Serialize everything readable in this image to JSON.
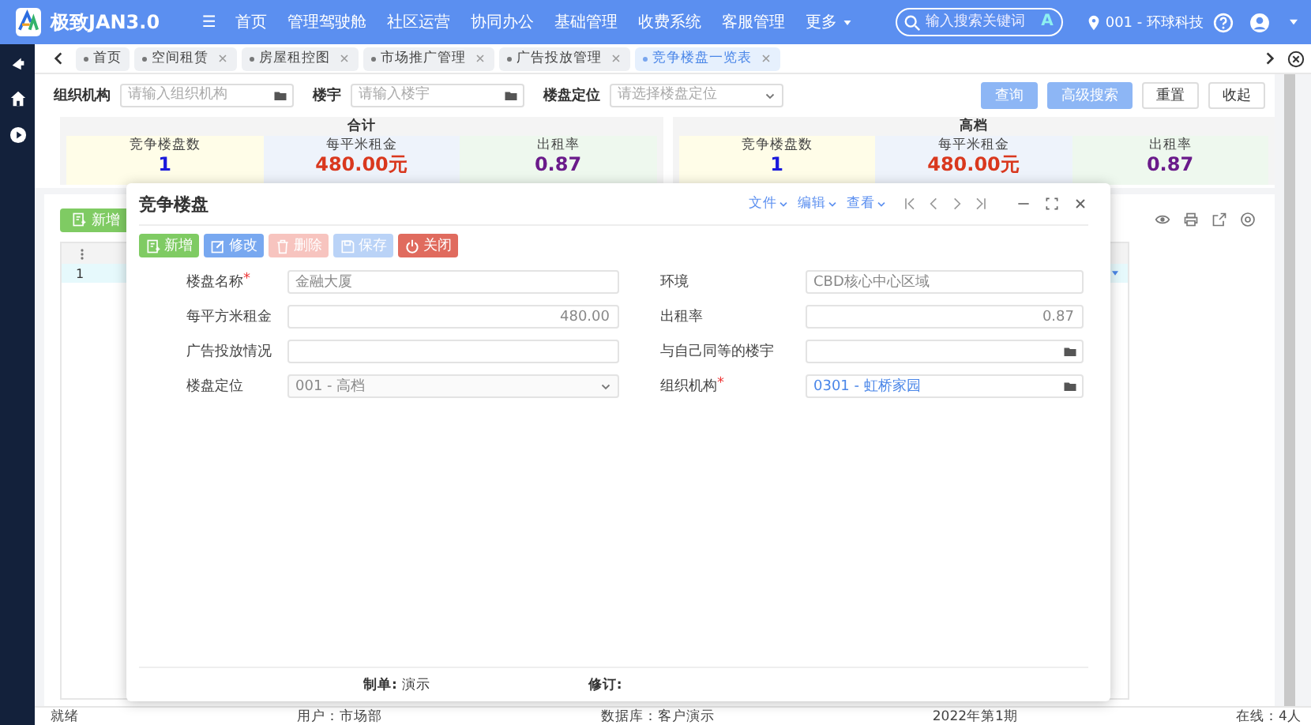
{
  "app": {
    "logo_text": "极致JAN3.0",
    "menu_icon": "☰",
    "nav": [
      "首页",
      "管理驾驶舱",
      "社区运营",
      "协同办公",
      "基础管理",
      "收费系统",
      "客服管理"
    ],
    "more": "更多",
    "search_placeholder": "输入搜索关键词",
    "search_badge": "A",
    "org": "001 - 环球科技"
  },
  "tabs": [
    {
      "label": "首页",
      "selected": false,
      "closable": false
    },
    {
      "label": "空间租赁",
      "selected": false,
      "closable": true
    },
    {
      "label": "房屋租控图",
      "selected": false,
      "closable": true
    },
    {
      "label": "市场推广管理",
      "selected": false,
      "closable": true
    },
    {
      "label": "广告投放管理",
      "selected": false,
      "closable": true
    },
    {
      "label": "竞争楼盘一览表",
      "selected": true,
      "closable": true
    }
  ],
  "filters": [
    {
      "label": "组织机构",
      "placeholder": "请输入组织机构",
      "kind": "picker"
    },
    {
      "label": "楼宇",
      "placeholder": "请输入楼宇",
      "kind": "picker"
    },
    {
      "label": "楼盘定位",
      "placeholder": "请选择楼盘定位",
      "kind": "select"
    }
  ],
  "filter_buttons": [
    {
      "label": "查询",
      "kind": "primary"
    },
    {
      "label": "高级搜索",
      "kind": "primary"
    },
    {
      "label": "重置",
      "kind": "default"
    },
    {
      "label": "收起",
      "kind": "default"
    }
  ],
  "summary": [
    {
      "title": "合计",
      "metrics": [
        {
          "label": "竞争楼盘数",
          "value": "1",
          "color": "#1a1adb"
        },
        {
          "label": "每平米租金",
          "value": "480.00元",
          "color": "#d9381e"
        },
        {
          "label": "出租率",
          "value": "0.87",
          "color": "#6a1b8a"
        }
      ]
    },
    {
      "title": "高档",
      "metrics": [
        {
          "label": "竞争楼盘数",
          "value": "1",
          "color": "#1a1adb"
        },
        {
          "label": "每平米租金",
          "value": "480.00元",
          "color": "#d9381e"
        },
        {
          "label": "出租率",
          "value": "0.87",
          "color": "#6a1b8a"
        }
      ]
    }
  ],
  "list": {
    "add_button": "新增",
    "row_number": "1"
  },
  "dialog": {
    "title": "竞争楼盘",
    "menus": [
      "文件",
      "编辑",
      "查看"
    ],
    "buttons": [
      {
        "label": "新增",
        "kind": "add",
        "disabled": false
      },
      {
        "label": "修改",
        "kind": "edit",
        "disabled": false
      },
      {
        "label": "删除",
        "kind": "delete",
        "disabled": true
      },
      {
        "label": "保存",
        "kind": "save",
        "disabled": true
      },
      {
        "label": "关闭",
        "kind": "close",
        "disabled": false
      }
    ],
    "fields": [
      {
        "label": "楼盘名称",
        "required_mark": "*",
        "kind": "text",
        "value": "金融大厦"
      },
      {
        "label": "环境",
        "kind": "text",
        "value": "CBD核心中心区域"
      },
      {
        "label": "每平方米租金",
        "kind": "number",
        "value": "480.00"
      },
      {
        "label": "出租率",
        "kind": "number",
        "value": "0.87"
      },
      {
        "label": "广告投放情况",
        "kind": "text"
      },
      {
        "label": "与自己同等的楼宇",
        "kind": "picker"
      },
      {
        "label": "楼盘定位",
        "kind": "select",
        "value": "001 - 高档"
      },
      {
        "label": "组织机构",
        "required_mark": "*",
        "kind": "picker",
        "value": "0301 - 虹桥家园"
      }
    ],
    "footer": [
      {
        "label": "制单:",
        "value": "演示"
      },
      {
        "label": "修订:"
      }
    ]
  },
  "status_bar": [
    "就绪",
    "用户：市场部",
    "数据库：客户演示",
    "2022年第1期",
    "在线：4人"
  ]
}
